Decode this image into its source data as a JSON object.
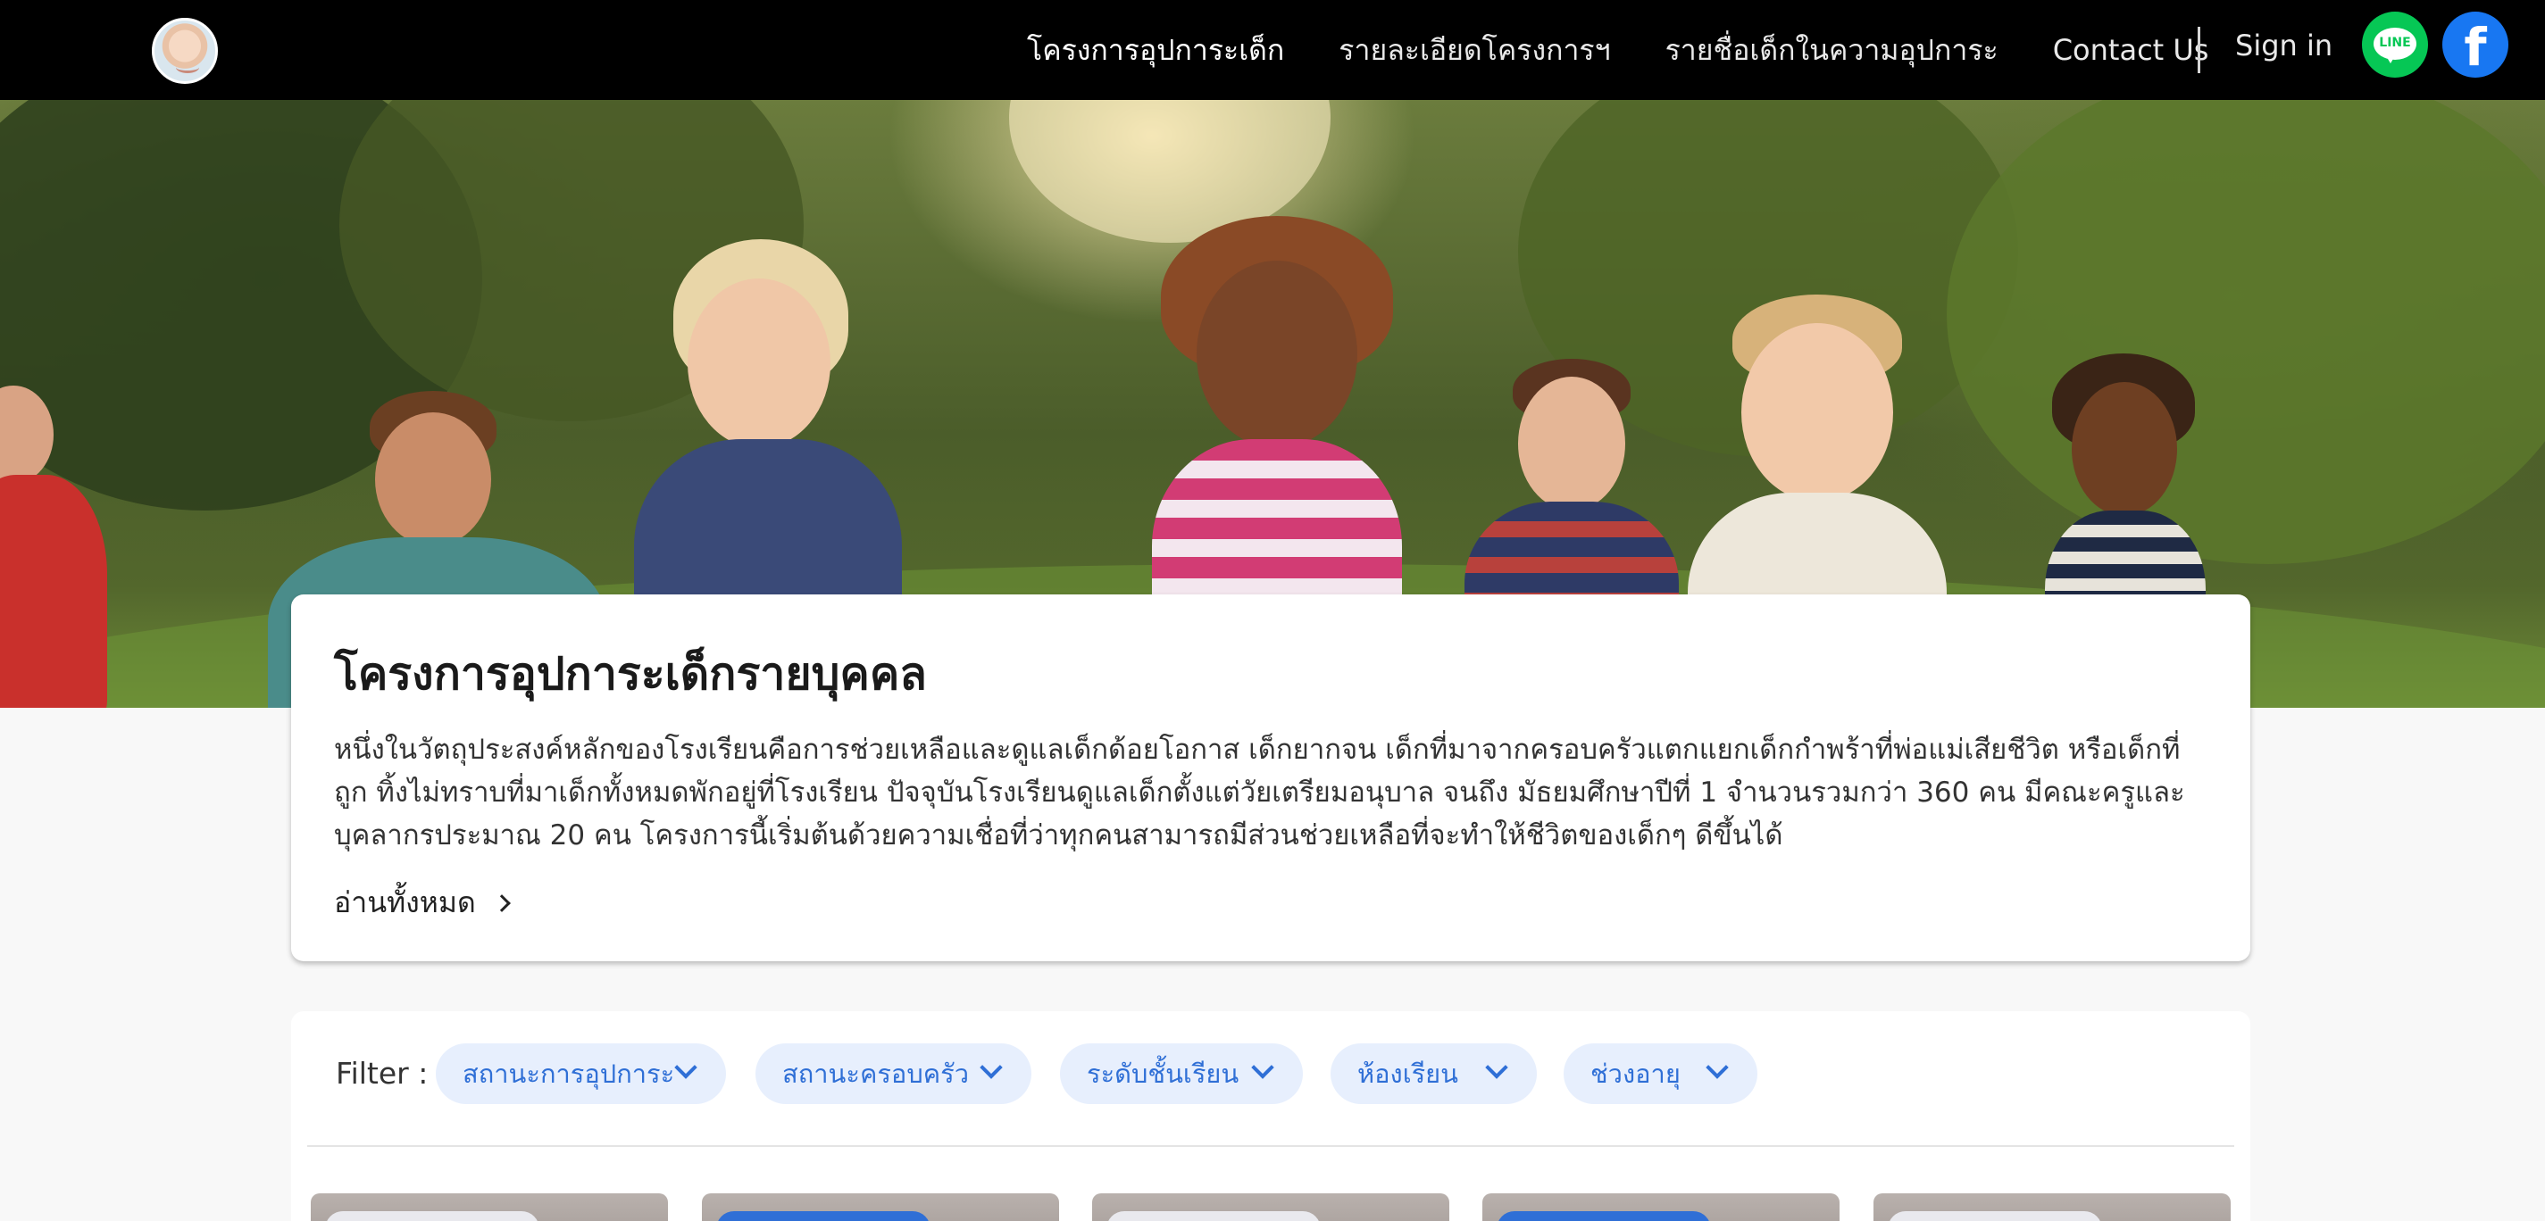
{
  "nav": {
    "links": [
      {
        "label": "โครงการอุปการะเด็ก",
        "active": true
      },
      {
        "label": "รายละเอียดโครงการฯ",
        "active": false
      },
      {
        "label": "รายชื่อเด็กในความอุปการะ",
        "active": false
      },
      {
        "label": "Contact Us",
        "active": false
      }
    ],
    "signin": "Sign in",
    "social": [
      {
        "icon": "line-icon",
        "text": "LINE",
        "color": "#06c755"
      },
      {
        "icon": "facebook-icon",
        "text": "f",
        "color": "#1877f2"
      }
    ]
  },
  "intro": {
    "title": "โครงการอุปการะเด็กรายบุคคล",
    "lines": [
      "หนึ่งในวัตถุประสงค์หลักของโรงเรียนคือการช่วยเหลือและดูแลเด็กด้อยโอกาส เด็กยากจน เด็กที่มาจากครอบครัวแตกแยกเด็กกำพร้าที่พ่อแม่เสียชีวิต หรือเด็กที่",
      "ถูก ทิ้งไม่ทราบที่มาเด็กทั้งหมดพักอยู่ที่โรงเรียน ปัจจุบันโรงเรียนดูแลเด็กตั้งแต่วัยเตรียมอนุบาล จนถึง มัธยมศึกษาปีที่ 1 จำนวนรวมกว่า 360 คน มีคณะครูและ",
      "บุคลากรประมาณ 20 คน โครงการนี้เริ่มต้นด้วยความเชื่อที่ว่าทุกคนสามารถมีส่วนช่วยเหลือที่จะทำให้ชีวิตของเด็กๆ ดีขึ้นได้"
    ],
    "read_more": "อ่านทั้งหมด"
  },
  "filter": {
    "label": "Filter :",
    "options": [
      "สถานะการอุปการะ",
      "สถานะครอบครัว",
      "ระดับชั้นเรียน",
      "ห้องเรียน",
      "ช่วงอายุ"
    ]
  },
  "colors": {
    "navbar": "#000000",
    "chip_bg": "#e7effd",
    "chip_text": "#2f6fd6",
    "tag_blue": "#2f6fd6",
    "tag_light": "#e9e9ee"
  }
}
